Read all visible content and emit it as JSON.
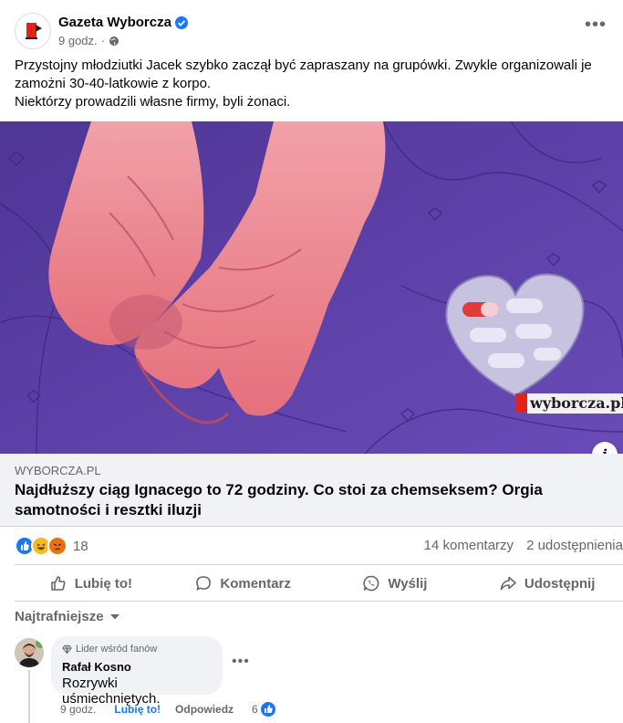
{
  "post": {
    "page_name": "Gazeta Wyborcza",
    "time": "9 godz.",
    "separator": "·",
    "text_lines": [
      "Przystojny młodziutki Jacek szybko zaczął być zapraszany na grupówki. Zwykle organizowali je zamożni 30-40-latkowie z korpo.",
      "Niektórzy prowadzili własne firmy, byli żonaci."
    ],
    "more_icon": "•••"
  },
  "image": {
    "watermark": "wyborcza.pl",
    "info_icon": "i"
  },
  "link": {
    "domain": "WYBORCZA.PL",
    "title": "Najdłuższy ciąg Ignacego to 72 godziny. Co stoi za chemseksem? Orgia samotności i resztki iluzji"
  },
  "reactions": {
    "count": "18",
    "comments": "14 komentarzy",
    "shares": "2 udostępnienia"
  },
  "actions": {
    "like": "Lubię to!",
    "comment": "Komentarz",
    "send": "Wyślij",
    "share": "Udostępnij"
  },
  "comments_section": {
    "sort_label": "Najtrafniejsze",
    "comment": {
      "badge": "Lider wśród fanów",
      "author": "Rafał Kosno",
      "text": "Rozrywki uśmiechniętych.",
      "time": "9 godz.",
      "like": "Lubię to!",
      "reply": "Odpowiedz",
      "like_count": "6",
      "more_icon": "•••"
    }
  },
  "colors": {
    "accent": "#1877f2",
    "secondary_text": "#65676b",
    "link_bg": "#f0f2f5",
    "image_bg": "#5b3fa8"
  }
}
